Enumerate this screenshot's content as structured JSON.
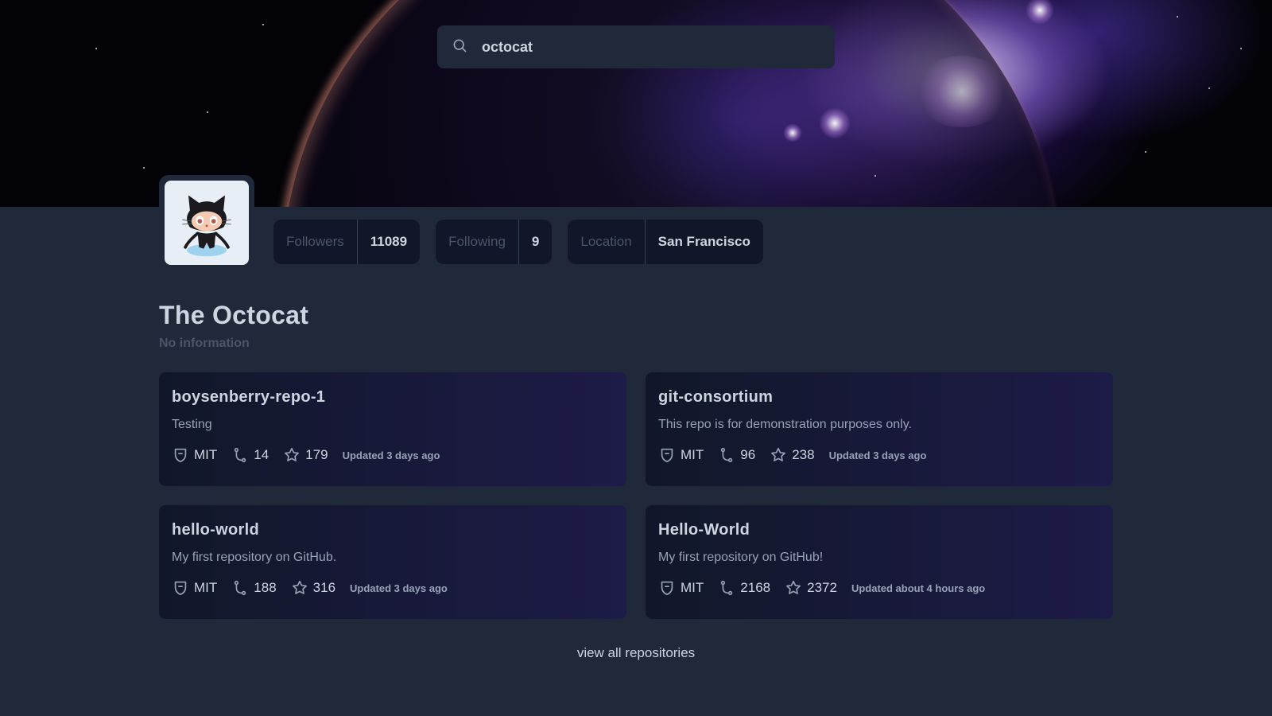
{
  "search": {
    "value": "octocat",
    "icon": "search-icon"
  },
  "profile": {
    "name": "The Octocat",
    "bio": "No information",
    "avatar_icon": "octocat-avatar"
  },
  "stats": [
    {
      "label": "Followers",
      "value": "11089"
    },
    {
      "label": "Following",
      "value": "9"
    },
    {
      "label": "Location",
      "value": "San Francisco"
    }
  ],
  "repos": [
    {
      "name": "boysenberry-repo-1",
      "description": "Testing",
      "license": "MIT",
      "forks": "14",
      "stars": "179",
      "updated": "Updated 3 days ago"
    },
    {
      "name": "git-consortium",
      "description": "This repo is for demonstration purposes only.",
      "license": "MIT",
      "forks": "96",
      "stars": "238",
      "updated": "Updated 3 days ago"
    },
    {
      "name": "hello-world",
      "description": "My first repository on GitHub.",
      "license": "MIT",
      "forks": "188",
      "stars": "316",
      "updated": "Updated 3 days ago"
    },
    {
      "name": "Hello-World",
      "description": "My first repository on GitHub!",
      "license": "MIT",
      "forks": "2168",
      "stars": "2372",
      "updated": "Updated about 4 hours ago"
    }
  ],
  "view_all_label": "view all repositories",
  "colors": {
    "background": "#20293a",
    "card_start": "#111729",
    "card_end": "#1d1b48",
    "text": "#cdd5e0",
    "muted": "#4a5567",
    "secondary": "#97a3b6"
  }
}
